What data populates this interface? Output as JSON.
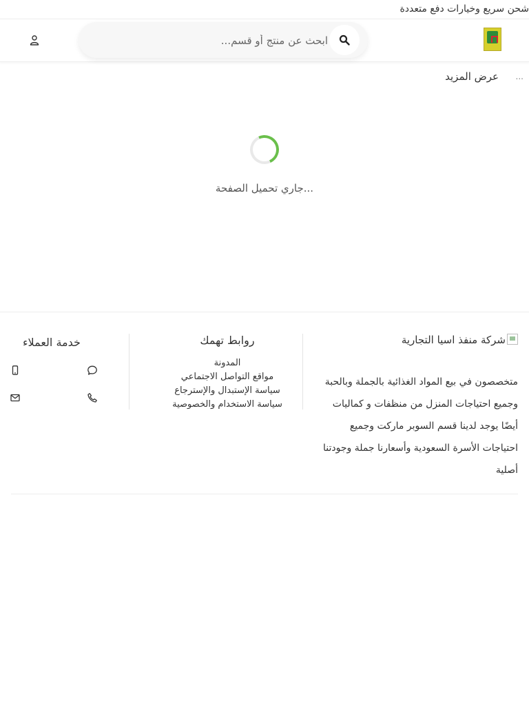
{
  "topbar": {
    "text": "شحن سريع وخيارات دفع متعددة"
  },
  "header": {
    "logo_icon": "store-logo",
    "search": {
      "placeholder": "ابحث عن منتج أو قسم...",
      "icon": "search-icon"
    },
    "user_icon": "user-icon"
  },
  "section": {
    "more_link": "عرض المزيد",
    "dots": "..."
  },
  "loading": {
    "text": "جاري تحميل الصفحة...",
    "spinner_color": "#6abf4b"
  },
  "footer": {
    "about": {
      "brand_alt": "شركة منفذ اسيا التجارية",
      "lines": [
        "متخصصون في بيع المواد الغذائية بالجملة وبالحبة",
        "وجميع احتياجات المنزل من منظفات و كماليات",
        "أيضًا يوجد لدينا قسم السوبر ماركت وجميع",
        "احتياجات الأسرة السعودية وأسعارنا جملة وجودتنا",
        "أصلية"
      ]
    },
    "links": {
      "title": "روابط تهمك",
      "items": [
        "المدونة",
        "مواقع التواصل الاجتماعي",
        "سياسة الإستبدال والإسترجاع",
        "سياسة الاستخدام والخصوصية"
      ]
    },
    "support": {
      "title": "خدمة العملاء",
      "icons": [
        "chat-icon",
        "mobile-icon",
        "phone-icon",
        "email-icon"
      ]
    }
  }
}
